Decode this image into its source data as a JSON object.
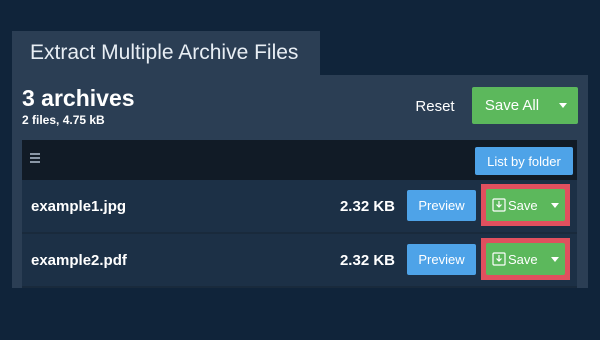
{
  "window": {
    "title": "Extract Multiple Archive Files"
  },
  "summary": {
    "count_label": "3 archives",
    "detail": "2 files, 4.75 kB"
  },
  "toolbar": {
    "reset_label": "Reset",
    "save_all_label": "Save All"
  },
  "list": {
    "menu_icon": "menu-icon",
    "list_by_folder_label": "List by folder",
    "files": [
      {
        "name": "example1.jpg",
        "size": "2.32 KB",
        "preview_label": "Preview",
        "save_label": "Save"
      },
      {
        "name": "example2.pdf",
        "size": "2.32 KB",
        "preview_label": "Preview",
        "save_label": "Save"
      }
    ]
  },
  "colors": {
    "background": "#10243a",
    "panel": "#2b3e54",
    "success": "#5cb85c",
    "primary": "#4ea3e8",
    "highlight": "#e0505e"
  }
}
